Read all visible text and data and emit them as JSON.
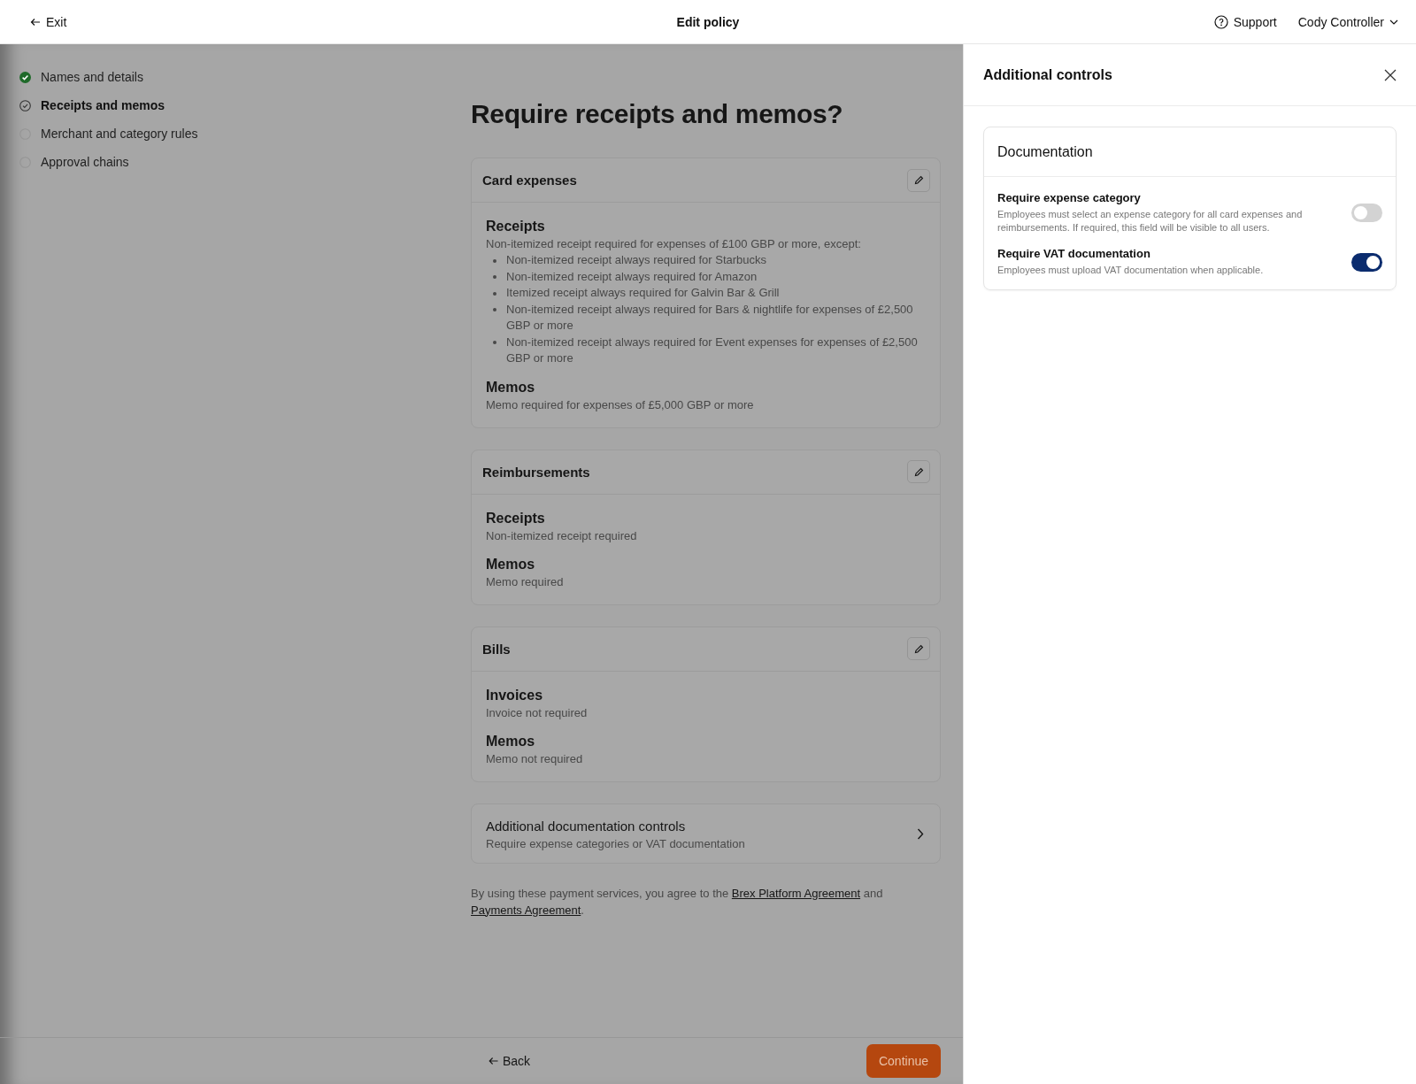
{
  "header": {
    "exit": "Exit",
    "title": "Edit policy",
    "support": "Support",
    "user": "Cody Controller"
  },
  "steps": [
    {
      "label": "Names and details",
      "complete": true,
      "selected": false
    },
    {
      "label": "Receipts and memos",
      "complete": false,
      "selected": true
    },
    {
      "label": "Merchant and category rules",
      "complete": false,
      "selected": false
    },
    {
      "label": "Approval chains",
      "complete": false,
      "selected": false
    }
  ],
  "page": {
    "heading": "Require receipts and memos?",
    "sections": [
      {
        "title": "Card expenses",
        "blocks": [
          {
            "title": "Receipts",
            "text": "Non-itemized receipt required for expenses of £100 GBP or more, except:",
            "bullets": [
              "Non-itemized receipt always required for Starbucks",
              "Non-itemized receipt always required for Amazon",
              "Itemized receipt always required for Galvin Bar & Grill",
              "Non-itemized receipt always required for Bars & nightlife for expenses of £2,500 GBP or more",
              "Non-itemized receipt always required for Event expenses for expenses of £2,500 GBP or more"
            ]
          },
          {
            "title": "Memos",
            "text": "Memo required for expenses of £5,000 GBP or more"
          }
        ]
      },
      {
        "title": "Reimbursements",
        "blocks": [
          {
            "title": "Receipts",
            "text": "Non-itemized receipt required"
          },
          {
            "title": "Memos",
            "text": "Memo required"
          }
        ]
      },
      {
        "title": "Bills",
        "blocks": [
          {
            "title": "Invoices",
            "text": "Invoice not required"
          },
          {
            "title": "Memos",
            "text": "Memo not required"
          }
        ]
      }
    ],
    "more": {
      "title": "Additional documentation controls",
      "subtitle": "Require expense categories or VAT documentation"
    },
    "agreement": [
      {
        "kind": "text",
        "text": "By using these payment services, you agree to the "
      },
      {
        "kind": "link",
        "text": "Brex Platform Agreement"
      },
      {
        "kind": "text",
        "text": " and "
      },
      {
        "kind": "link",
        "text": "Payments Agreement"
      },
      {
        "kind": "text",
        "text": "."
      }
    ]
  },
  "footer": {
    "back": "Back",
    "continue": "Continue"
  },
  "panel": {
    "title": "Additional controls",
    "card": {
      "title": "Documentation",
      "controls": [
        {
          "label": "Require expense category",
          "description": "Employees must select an expense category for all card expenses and reimbursements. If required, this field will be visible to all users.",
          "on": false
        },
        {
          "label": "Require VAT documentation",
          "description": "Employees must upload VAT documentation when applicable.",
          "on": true
        }
      ]
    }
  }
}
